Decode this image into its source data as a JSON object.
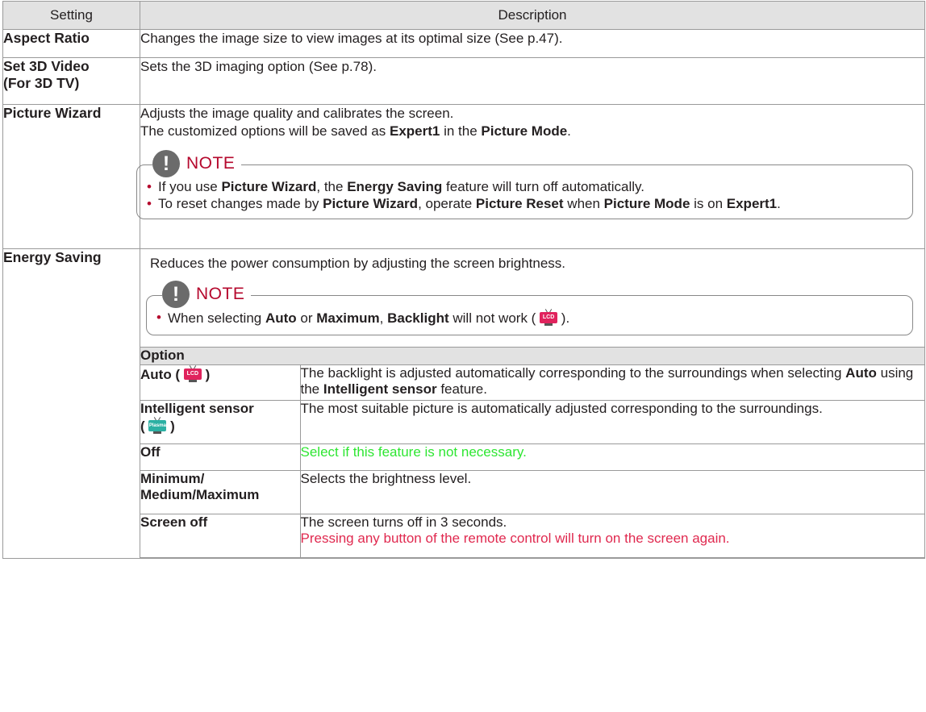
{
  "table": {
    "header_setting": "Setting",
    "header_description": "Description"
  },
  "rows": {
    "aspect": {
      "name": "Aspect Ratio",
      "desc": "Changes the image size to view images at its optimal size (See p.47)."
    },
    "video3d": {
      "name_line1": "Set 3D Video",
      "name_line2": "(For 3D TV)",
      "desc": "Sets the 3D imaging option (See p.78)."
    },
    "wizard": {
      "name": "Picture Wizard",
      "line1": "Adjusts the image quality and calibrates the screen.",
      "line2_a": "The customized options will be saved as ",
      "line2_b": "Expert1",
      "line2_c": " in the ",
      "line2_d": "Picture Mode",
      "line2_e": ".",
      "note": {
        "icon": "!",
        "label": "NOTE",
        "b1_a": "If you use ",
        "b1_b": "Picture Wizard",
        "b1_c": ", the ",
        "b1_d": "Energy Saving",
        "b1_e": " feature will turn off automatically.",
        "b2_a": "To reset changes made by ",
        "b2_b": "Picture Wizard",
        "b2_c": ", operate ",
        "b2_d": "Picture Reset",
        "b2_e": " when ",
        "b2_f": "Picture Mode",
        "b2_g": " is on ",
        "b2_h": "Expert1",
        "b2_i": "."
      }
    },
    "energy": {
      "name": "Energy Saving",
      "desc": "Reduces the power consumption by adjusting the screen brightness.",
      "note": {
        "icon": "!",
        "label": "NOTE",
        "b1_a": "When selecting ",
        "b1_b": "Auto",
        "b1_c": " or ",
        "b1_d": "Maximum",
        "b1_e": ", ",
        "b1_f": "Backlight",
        "b1_g": " will not work ( ",
        "b1_h": " )."
      },
      "options": {
        "header": "Option",
        "auto": {
          "name": "Auto (",
          "name_end": ")",
          "desc_a": "The backlight is adjusted automatically corresponding to the surroundings when selecting ",
          "desc_b": "Auto",
          "desc_c": " using the ",
          "desc_d": "Intelligent sensor",
          "desc_e": " feature."
        },
        "sensor": {
          "name_line1": "Intelligent sensor",
          "name_open": "(",
          "name_close": ")",
          "desc": "The most suitable picture is automatically adjusted corresponding to the surroundings."
        },
        "off": {
          "name": "Off",
          "desc": "Select if this feature is not necessary."
        },
        "level": {
          "name_line1": "Minimum/",
          "name_line2": "Medium/Maximum",
          "desc": "Selects the brightness level."
        },
        "screenoff": {
          "name": "Screen off",
          "desc_line1": "The screen turns off in 3 seconds.",
          "desc_line2": "Pressing any button of the remote control will turn on the screen again."
        }
      }
    }
  },
  "icons": {
    "lcd_text": "LCD",
    "plasma_text": "Plasma"
  },
  "colors": {
    "note_accent": "#b5082d",
    "header_bg": "#e2e2e2",
    "green_text": "#2ee632",
    "red_text": "#e0294f",
    "lcd_icon": "#e0235d",
    "plasma_icon": "#2bb0a3"
  }
}
